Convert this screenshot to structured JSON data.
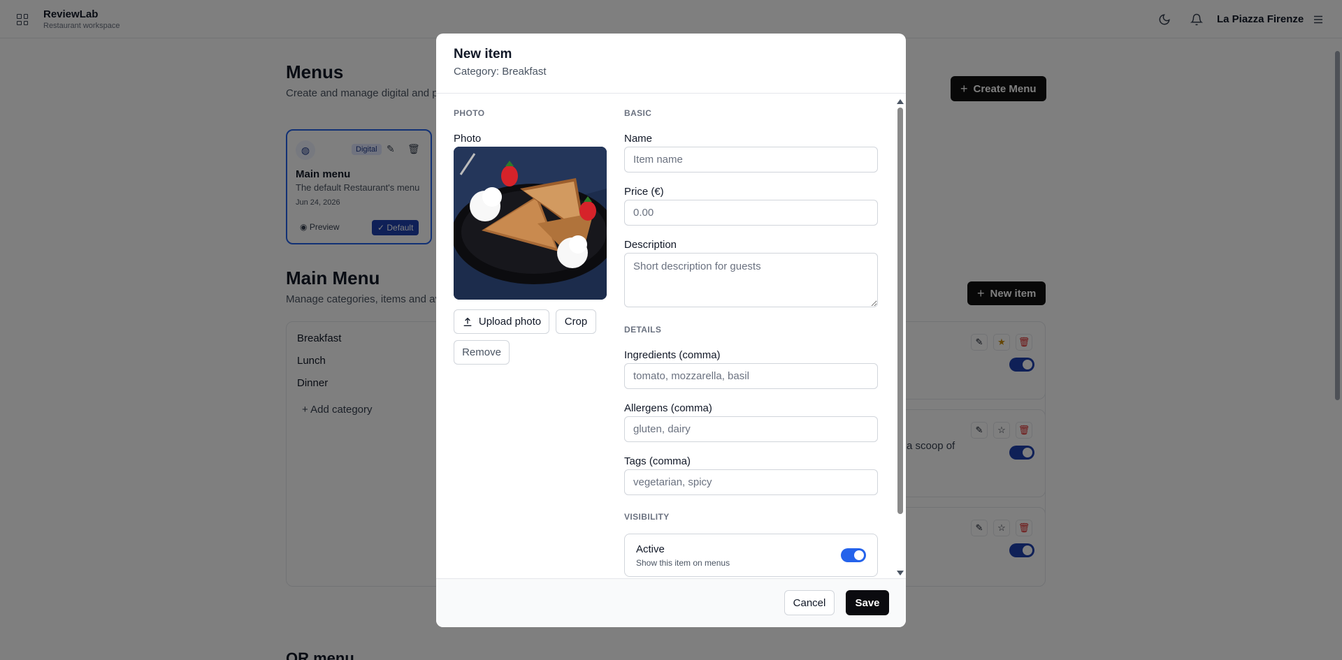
{
  "app": {
    "name": "ReviewLab",
    "subtitle": "Restaurant workspace",
    "workspace": "La Piazza Firenze"
  },
  "menus": {
    "title": "Menus",
    "subtitle": "Create and manage digital and p",
    "create_label": "Create Menu",
    "card": {
      "badge": "Digital",
      "name": "Main menu",
      "description": "The default Restaurant's menu",
      "date": "Jun 24, 2026",
      "preview_label": "Preview",
      "default_label": "Default"
    }
  },
  "main_menu": {
    "title": "Main Menu",
    "subtitle": "Manage categories, items and av",
    "new_item_label": "New item",
    "categories": [
      "Breakfast",
      "Lunch",
      "Dinner"
    ],
    "add_category_label": "Add category",
    "item_description_fragment": "a scoop of"
  },
  "qr_section_title": "QR menu",
  "modal": {
    "title": "New item",
    "subtitle": "Category: Breakfast",
    "photo_section": "PHOTO",
    "photo_label": "Photo",
    "upload_label": "Upload photo",
    "crop_label": "Crop",
    "remove_label": "Remove",
    "basic_section": "BASIC",
    "name_label": "Name",
    "name_placeholder": "Item name",
    "price_label": "Price (€)",
    "price_placeholder": "0.00",
    "description_label": "Description",
    "description_placeholder": "Short description for guests",
    "details_section": "DETAILS",
    "ingredients_label": "Ingredients (comma)",
    "ingredients_placeholder": "tomato, mozzarella, basil",
    "allergens_label": "Allergens (comma)",
    "allergens_placeholder": "gluten, dairy",
    "tags_label": "Tags (comma)",
    "tags_placeholder": "vegetarian, spicy",
    "visibility_section": "VISIBILITY",
    "active_label": "Active",
    "active_desc": "Show this item on menus",
    "active_on": true,
    "cancel_label": "Cancel",
    "save_label": "Save"
  },
  "icons": {
    "apps": "grid-icon",
    "theme": "moon-icon",
    "notifications": "bell-icon",
    "menu": "hamburger-icon",
    "upload": "upload-icon"
  },
  "colors": {
    "accent": "#2563eb",
    "accent_dark": "#1e40af",
    "primary_button": "#111111"
  }
}
